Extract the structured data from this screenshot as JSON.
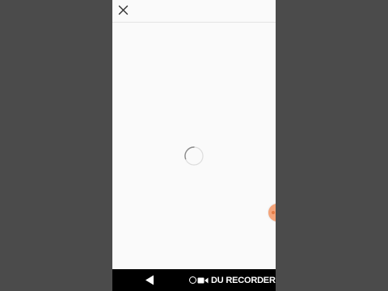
{
  "window": {
    "close_icon": "close-icon"
  },
  "content": {
    "state": "loading",
    "spinner_icon": "loading-spinner-icon"
  },
  "overlay": {
    "bubble_color": "#f4a47a"
  },
  "navbar": {
    "back_icon": "back-triangle-icon",
    "watermark_text": "DU RECORDER"
  },
  "colors": {
    "backdrop": "#4b4b4b",
    "screen": "#fafafa",
    "navbar": "#000000"
  }
}
